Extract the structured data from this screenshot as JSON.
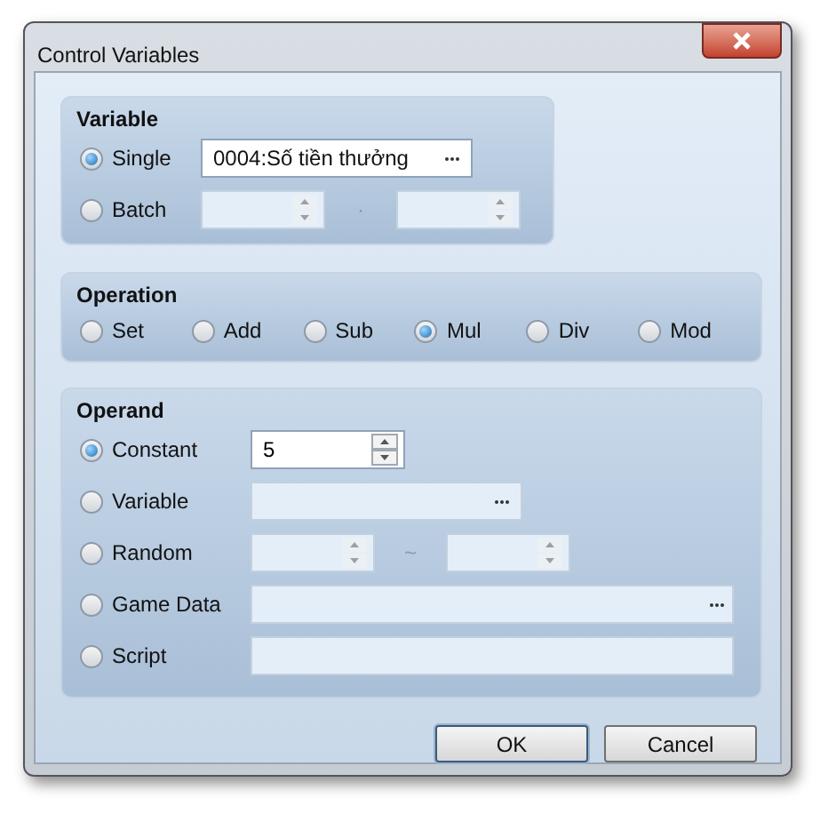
{
  "window": {
    "title": "Control Variables"
  },
  "variable": {
    "title": "Variable",
    "options": [
      {
        "label": "Single",
        "selected": true,
        "kind": "picker",
        "value": "0004:Số tiền thưởng"
      },
      {
        "label": "Batch",
        "selected": false,
        "kind": "range",
        "separator": "·"
      }
    ]
  },
  "operation": {
    "title": "Operation",
    "options": [
      {
        "label": "Set",
        "selected": false
      },
      {
        "label": "Add",
        "selected": false
      },
      {
        "label": "Sub",
        "selected": false
      },
      {
        "label": "Mul",
        "selected": true
      },
      {
        "label": "Div",
        "selected": false
      },
      {
        "label": "Mod",
        "selected": false
      }
    ]
  },
  "operand": {
    "title": "Operand",
    "options": [
      {
        "label": "Constant",
        "selected": true,
        "kind": "spin",
        "value": "5"
      },
      {
        "label": "Variable",
        "selected": false,
        "kind": "picker"
      },
      {
        "label": "Random",
        "selected": false,
        "kind": "range",
        "separator": "~"
      },
      {
        "label": "Game Data",
        "selected": false,
        "kind": "picker_wide"
      },
      {
        "label": "Script",
        "selected": false,
        "kind": "text"
      }
    ]
  },
  "buttons": [
    {
      "label": "OK",
      "default": true
    },
    {
      "label": "Cancel",
      "default": false
    }
  ]
}
